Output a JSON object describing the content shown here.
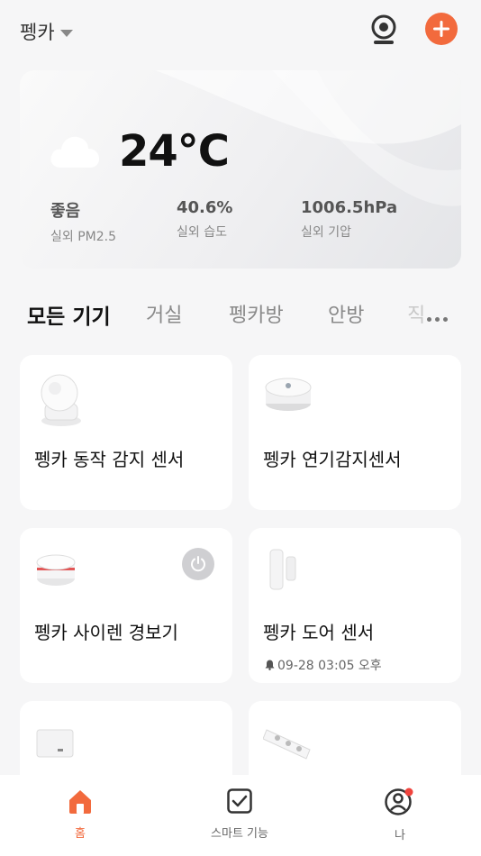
{
  "header": {
    "home_name": "펭카",
    "icons": [
      "chevron-down-icon",
      "camera-icon",
      "add-icon"
    ],
    "accent_color": "#f26a3d"
  },
  "weather": {
    "condition_icon": "cloud-icon",
    "temperature": "24°C",
    "metrics": [
      {
        "value": "좋음",
        "label": "실외 PM2.5"
      },
      {
        "value": "40.6%",
        "label": "실외 습도"
      },
      {
        "value": "1006.5hPa",
        "label": "실외 기압"
      }
    ]
  },
  "tabs": [
    {
      "label": "모든 기기",
      "active": true
    },
    {
      "label": "거실",
      "active": false
    },
    {
      "label": "펭카방",
      "active": false
    },
    {
      "label": "안방",
      "active": false
    },
    {
      "label": "직",
      "active": false
    }
  ],
  "devices": [
    {
      "name": "펭카 동작 감지 센서",
      "icon": "motion-sensor-icon"
    },
    {
      "name": "펭카 연기감지센서",
      "icon": "smoke-detector-icon"
    },
    {
      "name": "펭카 사이렌 경보기",
      "icon": "siren-icon",
      "power_state": "off"
    },
    {
      "name": "펭카 도어 센서",
      "icon": "door-sensor-icon",
      "status": "09-28 03:05 오후"
    },
    {
      "name": "",
      "icon": "hub-icon"
    },
    {
      "name": "",
      "icon": "power-strip-icon"
    }
  ],
  "bottom_nav": [
    {
      "label": "홈",
      "icon": "home-icon",
      "active": true
    },
    {
      "label": "스마트 기능",
      "icon": "checkbox-icon",
      "active": false
    },
    {
      "label": "나",
      "icon": "user-icon",
      "active": false,
      "badge": true
    }
  ]
}
